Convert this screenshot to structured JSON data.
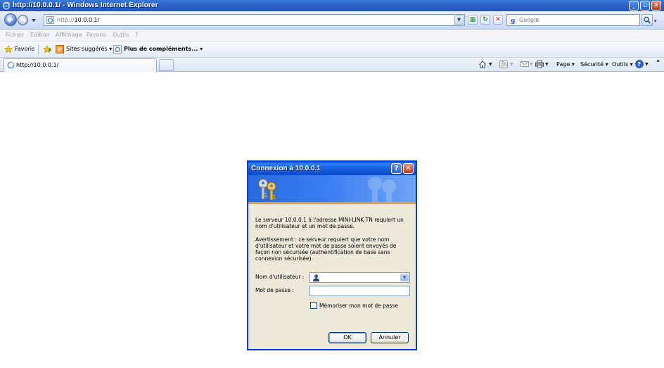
{
  "window": {
    "title": "http://10.0.0.1/ - Windows Internet Explorer",
    "buttons": {
      "minimize": "_",
      "maximize": "▫",
      "close": "✕"
    }
  },
  "addressbar": {
    "url_prefix": "http://",
    "url_host": "10.0.0.1/",
    "search_placeholder": "Google"
  },
  "menu": [
    "Fichier",
    "Edition",
    "Affichage",
    "Favoris",
    "Outils",
    "?"
  ],
  "favorites": {
    "favoris_label": "Favoris",
    "suggested_label": "Sites suggérés",
    "more_label": "Plus de compléments..."
  },
  "tab": {
    "label": "http://10.0.0.1/"
  },
  "commandbar": {
    "page": "Page",
    "security": "Sécurité",
    "tools": "Outils",
    "more": "»"
  },
  "dialog": {
    "title": "Connexion à 10.0.0.1",
    "message": "Le serveur 10.0.0.1 à l'adresse MINI-LINK TN requiert un nom d'utilisateur et un mot de passe.",
    "warning": "Avertissement : ce serveur requiert que votre nom d'utilisateur et votre mot de passe soient envoyés de façon non sécurisée (authentification de base sans connexion sécurisée).",
    "username_label": "Nom d'utilisateur :",
    "password_label": "Mot de passe :",
    "remember_label": "Mémoriser mon mot de passe",
    "ok_label": "OK",
    "cancel_label": "Annuler",
    "help": "?",
    "close": "✕"
  },
  "colors": {
    "titlebar": "#2c64c8",
    "dialog_bg": "#ece9d8",
    "banner": "#3b7cf0",
    "banner_stripe": "#f39b2a"
  }
}
